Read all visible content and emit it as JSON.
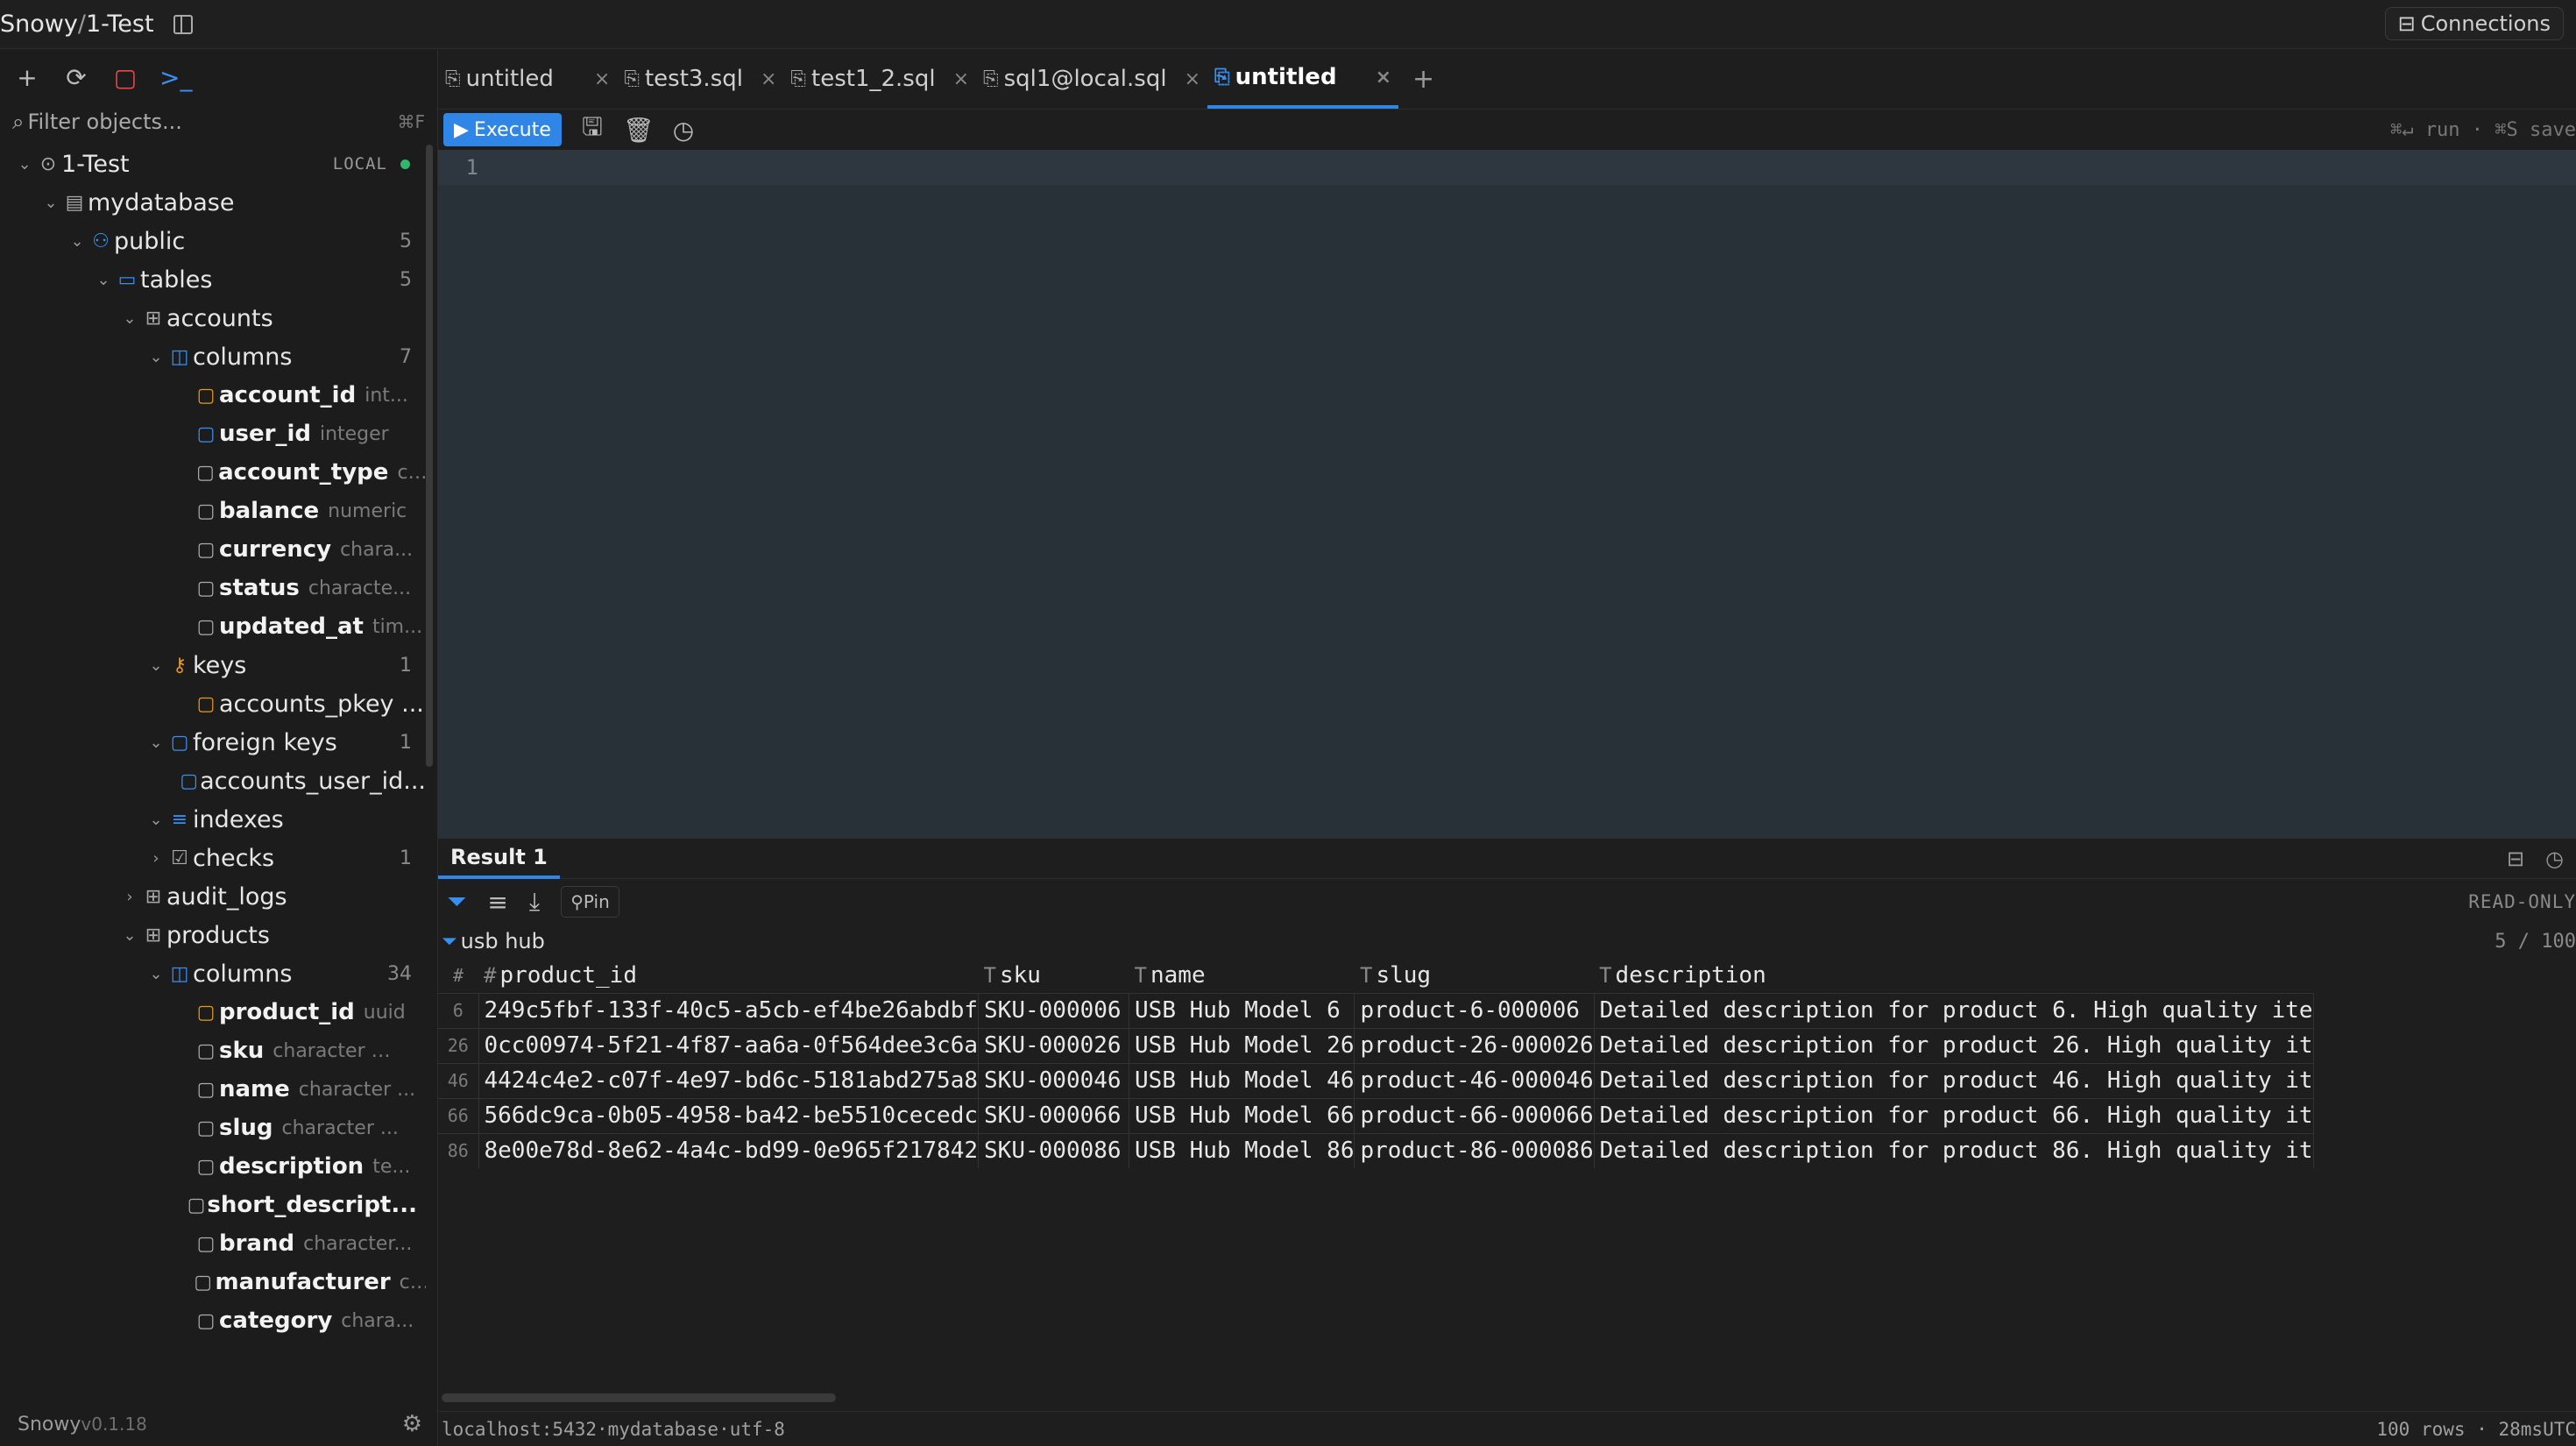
{
  "window": {
    "app": "Snowy",
    "connection": "1-Test",
    "connections_button": "Connections"
  },
  "sidebar": {
    "filter_placeholder": "Filter objects...",
    "filter_shortcut": "⌘F",
    "footer": {
      "app": "Snowy",
      "version": "v0.1.18"
    },
    "tree": [
      {
        "depth": 0,
        "chev": "⌄",
        "icon": "⊙",
        "icon_name": "connection-icon",
        "label": "1-Test",
        "badge": "LOCAL",
        "status": "online",
        "name": "tree-connection-1-test"
      },
      {
        "depth": 1,
        "chev": "⌄",
        "icon": "▤",
        "icon_name": "database-icon",
        "label": "mydatabase",
        "name": "tree-database-mydatabase"
      },
      {
        "depth": 2,
        "chev": "⌄",
        "icon": "⚇",
        "icon_name": "schema-icon",
        "label": "public",
        "count": "5",
        "name": "tree-schema-public",
        "color": "#3a8ef0"
      },
      {
        "depth": 3,
        "chev": "⌄",
        "icon": "▭",
        "icon_name": "folder-icon",
        "label": "tables",
        "count": "5",
        "name": "tree-folder-tables",
        "color": "#3a8ef0"
      },
      {
        "depth": 4,
        "chev": "⌄",
        "icon": "⊞",
        "icon_name": "table-icon",
        "label": "accounts",
        "name": "tree-table-accounts"
      },
      {
        "depth": 5,
        "chev": "⌄",
        "icon": "◫",
        "icon_name": "columns-icon",
        "label": "columns",
        "count": "7",
        "name": "tree-columns-accounts",
        "color": "#3a8ef0"
      },
      {
        "depth": 6,
        "col": true,
        "icon": "▢",
        "icon_name": "primary-key-column-icon",
        "label": "account_id",
        "type": "int...",
        "name": "tree-column-account-id",
        "color": "#e8961e"
      },
      {
        "depth": 6,
        "col": true,
        "icon": "▢",
        "icon_name": "foreign-key-column-icon",
        "label": "user_id",
        "type": "integer",
        "name": "tree-column-user-id",
        "color": "#3a8ef0"
      },
      {
        "depth": 6,
        "col": true,
        "icon": "▢",
        "icon_name": "column-icon",
        "label": "account_type",
        "type": "c...",
        "name": "tree-column-account-type"
      },
      {
        "depth": 6,
        "col": true,
        "icon": "▢",
        "icon_name": "column-icon",
        "label": "balance",
        "type": "numeric",
        "name": "tree-column-balance"
      },
      {
        "depth": 6,
        "col": true,
        "icon": "▢",
        "icon_name": "column-icon",
        "label": "currency",
        "type": "chara...",
        "name": "tree-column-currency"
      },
      {
        "depth": 6,
        "col": true,
        "icon": "▢",
        "icon_name": "column-icon",
        "label": "status",
        "type": "characte...",
        "name": "tree-column-status"
      },
      {
        "depth": 6,
        "col": true,
        "icon": "▢",
        "icon_name": "column-icon",
        "label": "updated_at",
        "type": "tim...",
        "name": "tree-column-updated-at"
      },
      {
        "depth": 5,
        "chev": "⌄",
        "icon": "⚷",
        "icon_name": "key-icon",
        "label": "keys",
        "count": "1",
        "name": "tree-keys-accounts",
        "color": "#e8961e"
      },
      {
        "depth": 6,
        "icon": "▢",
        "icon_name": "primary-key-icon",
        "label": "accounts_pkey ...",
        "name": "tree-key-accounts-pkey",
        "color": "#e8961e"
      },
      {
        "depth": 5,
        "chev": "⌄",
        "icon": "▢",
        "icon_name": "foreign-key-icon",
        "label": "foreign keys",
        "count": "1",
        "name": "tree-foreign-keys-accounts",
        "color": "#3a8ef0"
      },
      {
        "depth": 6,
        "icon": "▢",
        "icon_name": "foreign-key-icon",
        "label": "accounts_user_id...",
        "name": "tree-fk-accounts-user-id",
        "color": "#3a8ef0"
      },
      {
        "depth": 5,
        "chev": "⌄",
        "icon": "≡",
        "icon_name": "index-icon",
        "label": "indexes",
        "name": "tree-indexes-accounts",
        "color": "#3a8ef0"
      },
      {
        "depth": 5,
        "chev": "›",
        "icon": "☑",
        "icon_name": "check-icon",
        "label": "checks",
        "count": "1",
        "name": "tree-checks-accounts"
      },
      {
        "depth": 4,
        "chev": "›",
        "icon": "⊞",
        "icon_name": "table-icon",
        "label": "audit_logs",
        "name": "tree-table-audit-logs"
      },
      {
        "depth": 4,
        "chev": "⌄",
        "icon": "⊞",
        "icon_name": "table-icon",
        "label": "products",
        "name": "tree-table-products"
      },
      {
        "depth": 5,
        "chev": "⌄",
        "icon": "◫",
        "icon_name": "columns-icon",
        "label": "columns",
        "count": "34",
        "name": "tree-columns-products",
        "color": "#3a8ef0"
      },
      {
        "depth": 6,
        "col": true,
        "icon": "▢",
        "icon_name": "primary-key-column-icon",
        "label": "product_id",
        "type": "uuid",
        "name": "tree-column-product-id",
        "color": "#e8961e"
      },
      {
        "depth": 6,
        "col": true,
        "icon": "▢",
        "icon_name": "column-icon",
        "label": "sku",
        "type": "character v...",
        "name": "tree-column-sku"
      },
      {
        "depth": 6,
        "col": true,
        "icon": "▢",
        "icon_name": "column-icon",
        "label": "name",
        "type": "character ...",
        "name": "tree-column-name"
      },
      {
        "depth": 6,
        "col": true,
        "icon": "▢",
        "icon_name": "column-icon",
        "label": "slug",
        "type": "character ...",
        "name": "tree-column-slug"
      },
      {
        "depth": 6,
        "col": true,
        "icon": "▢",
        "icon_name": "column-icon",
        "label": "description",
        "type": "te...",
        "name": "tree-column-description"
      },
      {
        "depth": 6,
        "col": true,
        "icon": "▢",
        "icon_name": "column-icon",
        "label": "short_descript...",
        "type": "",
        "name": "tree-column-short-description"
      },
      {
        "depth": 6,
        "col": true,
        "icon": "▢",
        "icon_name": "column-icon",
        "label": "brand",
        "type": "character...",
        "name": "tree-column-brand"
      },
      {
        "depth": 6,
        "col": true,
        "icon": "▢",
        "icon_name": "column-icon",
        "label": "manufacturer",
        "type": "c...",
        "name": "tree-column-manufacturer"
      },
      {
        "depth": 6,
        "col": true,
        "icon": "▢",
        "icon_name": "column-icon",
        "label": "category",
        "type": "chara...",
        "name": "tree-column-category"
      }
    ]
  },
  "editor_tabs": [
    {
      "label": "untitled",
      "close": "×",
      "active": false
    },
    {
      "label": "test3.sql",
      "close": "×",
      "active": false
    },
    {
      "label": "test1_2.sql",
      "close": "×",
      "active": false
    },
    {
      "label": "sql1@local.sql",
      "close": "×",
      "active": false
    },
    {
      "label": "untitled",
      "close": "×",
      "active": true
    }
  ],
  "toolbar": {
    "execute": "Execute",
    "hint": "⌘↵ run · ⌘S save"
  },
  "editor": {
    "line_number": "1"
  },
  "results": {
    "tab": "Result 1",
    "pin": "Pin",
    "mode": "READ-ONLY",
    "filter_text": "usb hub",
    "row_count": "5 / 100",
    "columns": [
      {
        "type": "",
        "label": "#"
      },
      {
        "type": "#",
        "label": "product_id"
      },
      {
        "type": "T",
        "label": "sku"
      },
      {
        "type": "T",
        "label": "name"
      },
      {
        "type": "T",
        "label": "slug"
      },
      {
        "type": "T",
        "label": "description"
      }
    ],
    "rows": [
      [
        "6",
        "249c5fbf-133f-40c5-a5cb-ef4be26abdbf",
        "SKU-000006",
        "USB Hub Model 6",
        "product-6-000006",
        "Detailed description for product 6. High quality ite"
      ],
      [
        "26",
        "0cc00974-5f21-4f87-aa6a-0f564dee3c6a",
        "SKU-000026",
        "USB Hub Model 26",
        "product-26-000026",
        "Detailed description for product 26. High quality it"
      ],
      [
        "46",
        "4424c4e2-c07f-4e97-bd6c-5181abd275a8",
        "SKU-000046",
        "USB Hub Model 46",
        "product-46-000046",
        "Detailed description for product 46. High quality it"
      ],
      [
        "66",
        "566dc9ca-0b05-4958-ba42-be5510cecedc",
        "SKU-000066",
        "USB Hub Model 66",
        "product-66-000066",
        "Detailed description for product 66. High quality it"
      ],
      [
        "86",
        "8e00e78d-8e62-4a4c-bd99-0e965f217842",
        "SKU-000086",
        "USB Hub Model 86",
        "product-86-000086",
        "Detailed description for product 86. High quality it"
      ]
    ]
  },
  "status": {
    "connection": "localhost:5432·mydatabase·utf-8",
    "rows": "100 rows",
    "time": "28ms",
    "timezone": "UTC"
  }
}
